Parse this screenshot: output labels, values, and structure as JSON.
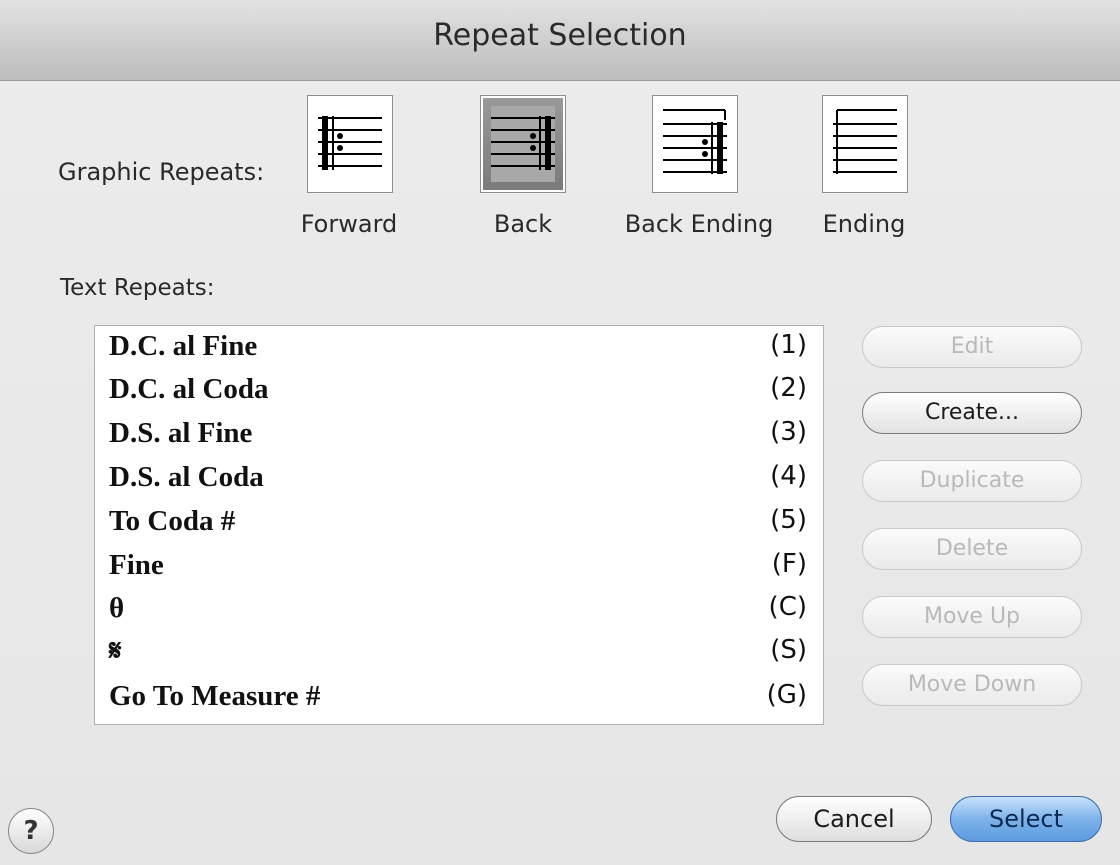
{
  "window": {
    "title": "Repeat Selection"
  },
  "graphic_repeats": {
    "label": "Graphic Repeats:",
    "options": [
      {
        "caption": "Forward",
        "icon": "forward-repeat-icon",
        "selected": false
      },
      {
        "caption": "Back",
        "icon": "back-repeat-icon",
        "selected": true
      },
      {
        "caption": "Back Ending",
        "icon": "back-ending-repeat-icon",
        "selected": false
      },
      {
        "caption": "Ending",
        "icon": "ending-repeat-icon",
        "selected": false
      }
    ]
  },
  "text_repeats": {
    "label": "Text Repeats:",
    "items": [
      {
        "name": "D.C. al Fine",
        "key": "(1)"
      },
      {
        "name": "D.C. al Coda",
        "key": "(2)"
      },
      {
        "name": "D.S. al Fine",
        "key": "(3)"
      },
      {
        "name": "D.S. al Coda",
        "key": "(4)"
      },
      {
        "name": "To Coda #",
        "key": "(5)"
      },
      {
        "name": "Fine",
        "key": "(F)"
      },
      {
        "name": "θ",
        "key": "(C)"
      },
      {
        "name": "𝄋",
        "key": "(S)"
      },
      {
        "name": "Go To Measure #",
        "key": "(G)"
      }
    ],
    "item_icons": {
      "coda": "coda-symbol-icon",
      "segno": "segno-symbol-icon"
    }
  },
  "side_buttons": {
    "edit": "Edit",
    "create": "Create...",
    "duplicate": "Duplicate",
    "delete": "Delete",
    "move_up": "Move Up",
    "move_down": "Move Down"
  },
  "footer": {
    "help": "?",
    "cancel": "Cancel",
    "select": "Select"
  },
  "colors": {
    "default_button": "#6aa6e6"
  }
}
